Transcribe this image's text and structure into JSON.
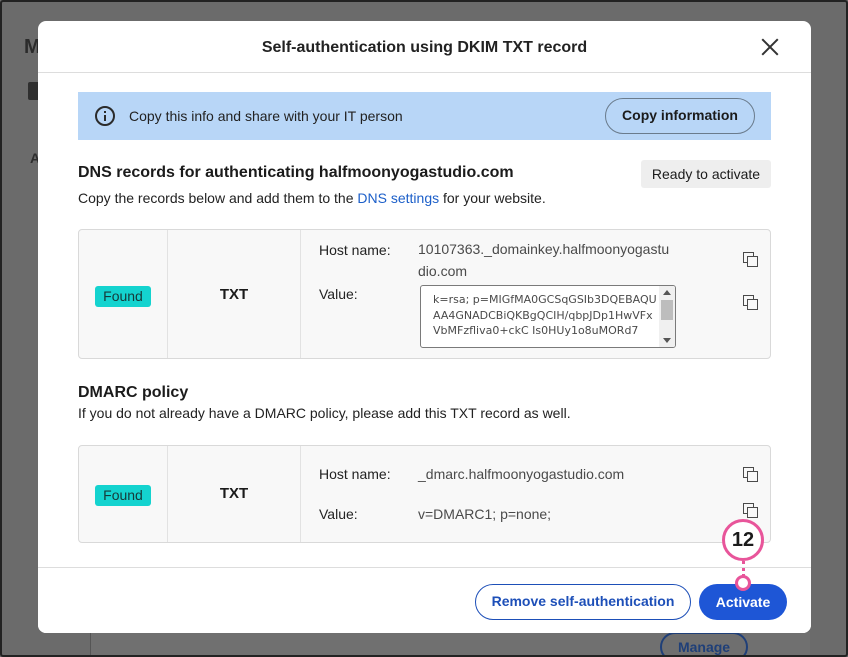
{
  "background": {
    "title_fragment": "M",
    "side_letter": "A",
    "manage_label": "Manage"
  },
  "modal": {
    "title": "Self-authentication using DKIM TXT record",
    "info_banner": {
      "text": "Copy this info and share with your IT person",
      "copy_button": "Copy information"
    },
    "dns_section": {
      "title": "DNS records for authenticating halfmoonyogastudio.com",
      "status_badge": "Ready to activate",
      "sub_prefix": "Copy the records below and add them to the ",
      "sub_link": "DNS settings",
      "sub_suffix": " for your website.",
      "record": {
        "status": "Found",
        "type": "TXT",
        "host_label": "Host name:",
        "host_value_line1": "10107363._domainkey.halfmoonyogastu",
        "host_value_line2": "dio.com",
        "value_label": "Value:",
        "value_text": "k=rsa; p=MIGfMA0GCSqGSIb3DQEBAQUAA4GNADCBiQKBgQCIH/qbpJDp1HwVFxVbMFzfliva0+ckC Is0HUy1o8uMORd7"
      }
    },
    "dmarc_section": {
      "title": "DMARC policy",
      "sub": "If you do not already have a DMARC policy, please add this TXT record as well.",
      "record": {
        "status": "Found",
        "type": "TXT",
        "host_label": "Host name:",
        "host_value": "_dmarc.halfmoonyogastudio.com",
        "value_label": "Value:",
        "value_text": "v=DMARC1; p=none;"
      }
    },
    "footer": {
      "remove_button": "Remove self-authentication",
      "activate_button": "Activate"
    }
  },
  "callout": {
    "step_number": "12"
  },
  "icons": [
    "close-icon",
    "info-icon",
    "copy-icon"
  ],
  "colors": {
    "accent": "#1e56d6",
    "found_badge": "#14d3cf",
    "info_banner": "#b8d6f7",
    "callout": "#e8559a"
  }
}
